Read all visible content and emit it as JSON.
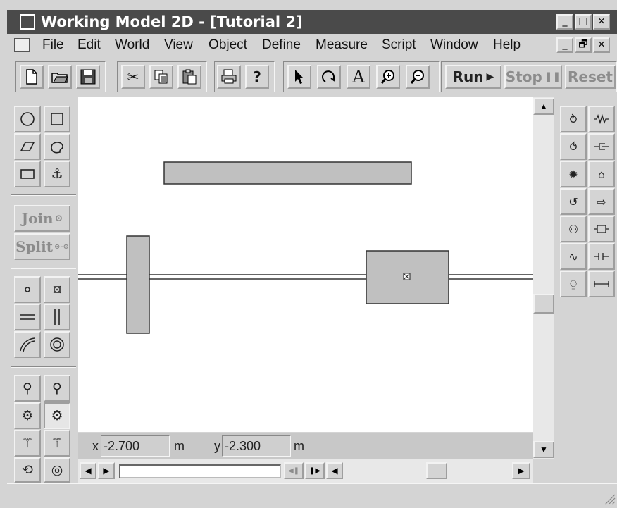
{
  "window": {
    "title": "Working Model 2D - [Tutorial 2]",
    "controls": [
      "_",
      "□",
      "×"
    ]
  },
  "menubar": {
    "items": [
      "File",
      "Edit",
      "World",
      "View",
      "Object",
      "Define",
      "Measure",
      "Script",
      "Window",
      "Help"
    ],
    "doc_controls": [
      "_",
      "🗗",
      "×"
    ]
  },
  "toolbar": {
    "file_icons": [
      "new-file-icon",
      "open-folder-icon",
      "save-disk-icon"
    ],
    "edit_icons": [
      "cut-icon",
      "copy-icon",
      "paste-icon"
    ],
    "misc_icons": [
      "print-icon",
      "help-icon"
    ],
    "tool_icons": [
      "arrow-pointer-icon",
      "rotate-icon",
      "text-icon",
      "zoom-in-icon",
      "zoom-out-icon"
    ],
    "run_label": "Run",
    "stop_label": "Stop",
    "reset_label": "Reset",
    "text_tool_glyph": "A",
    "help_glyph": "?"
  },
  "left_tools": {
    "join_label": "Join",
    "split_label": "Split"
  },
  "coords": {
    "x_label": "x",
    "x_value": "-2.700",
    "x_unit": "m",
    "y_label": "y",
    "y_value": "-2.300",
    "y_unit": "m"
  },
  "colors": {
    "body_fill": "#c0c0c0",
    "canvas": "#ffffff",
    "chrome": "#d4d4d4",
    "title_bar": "#4a4a4a"
  }
}
